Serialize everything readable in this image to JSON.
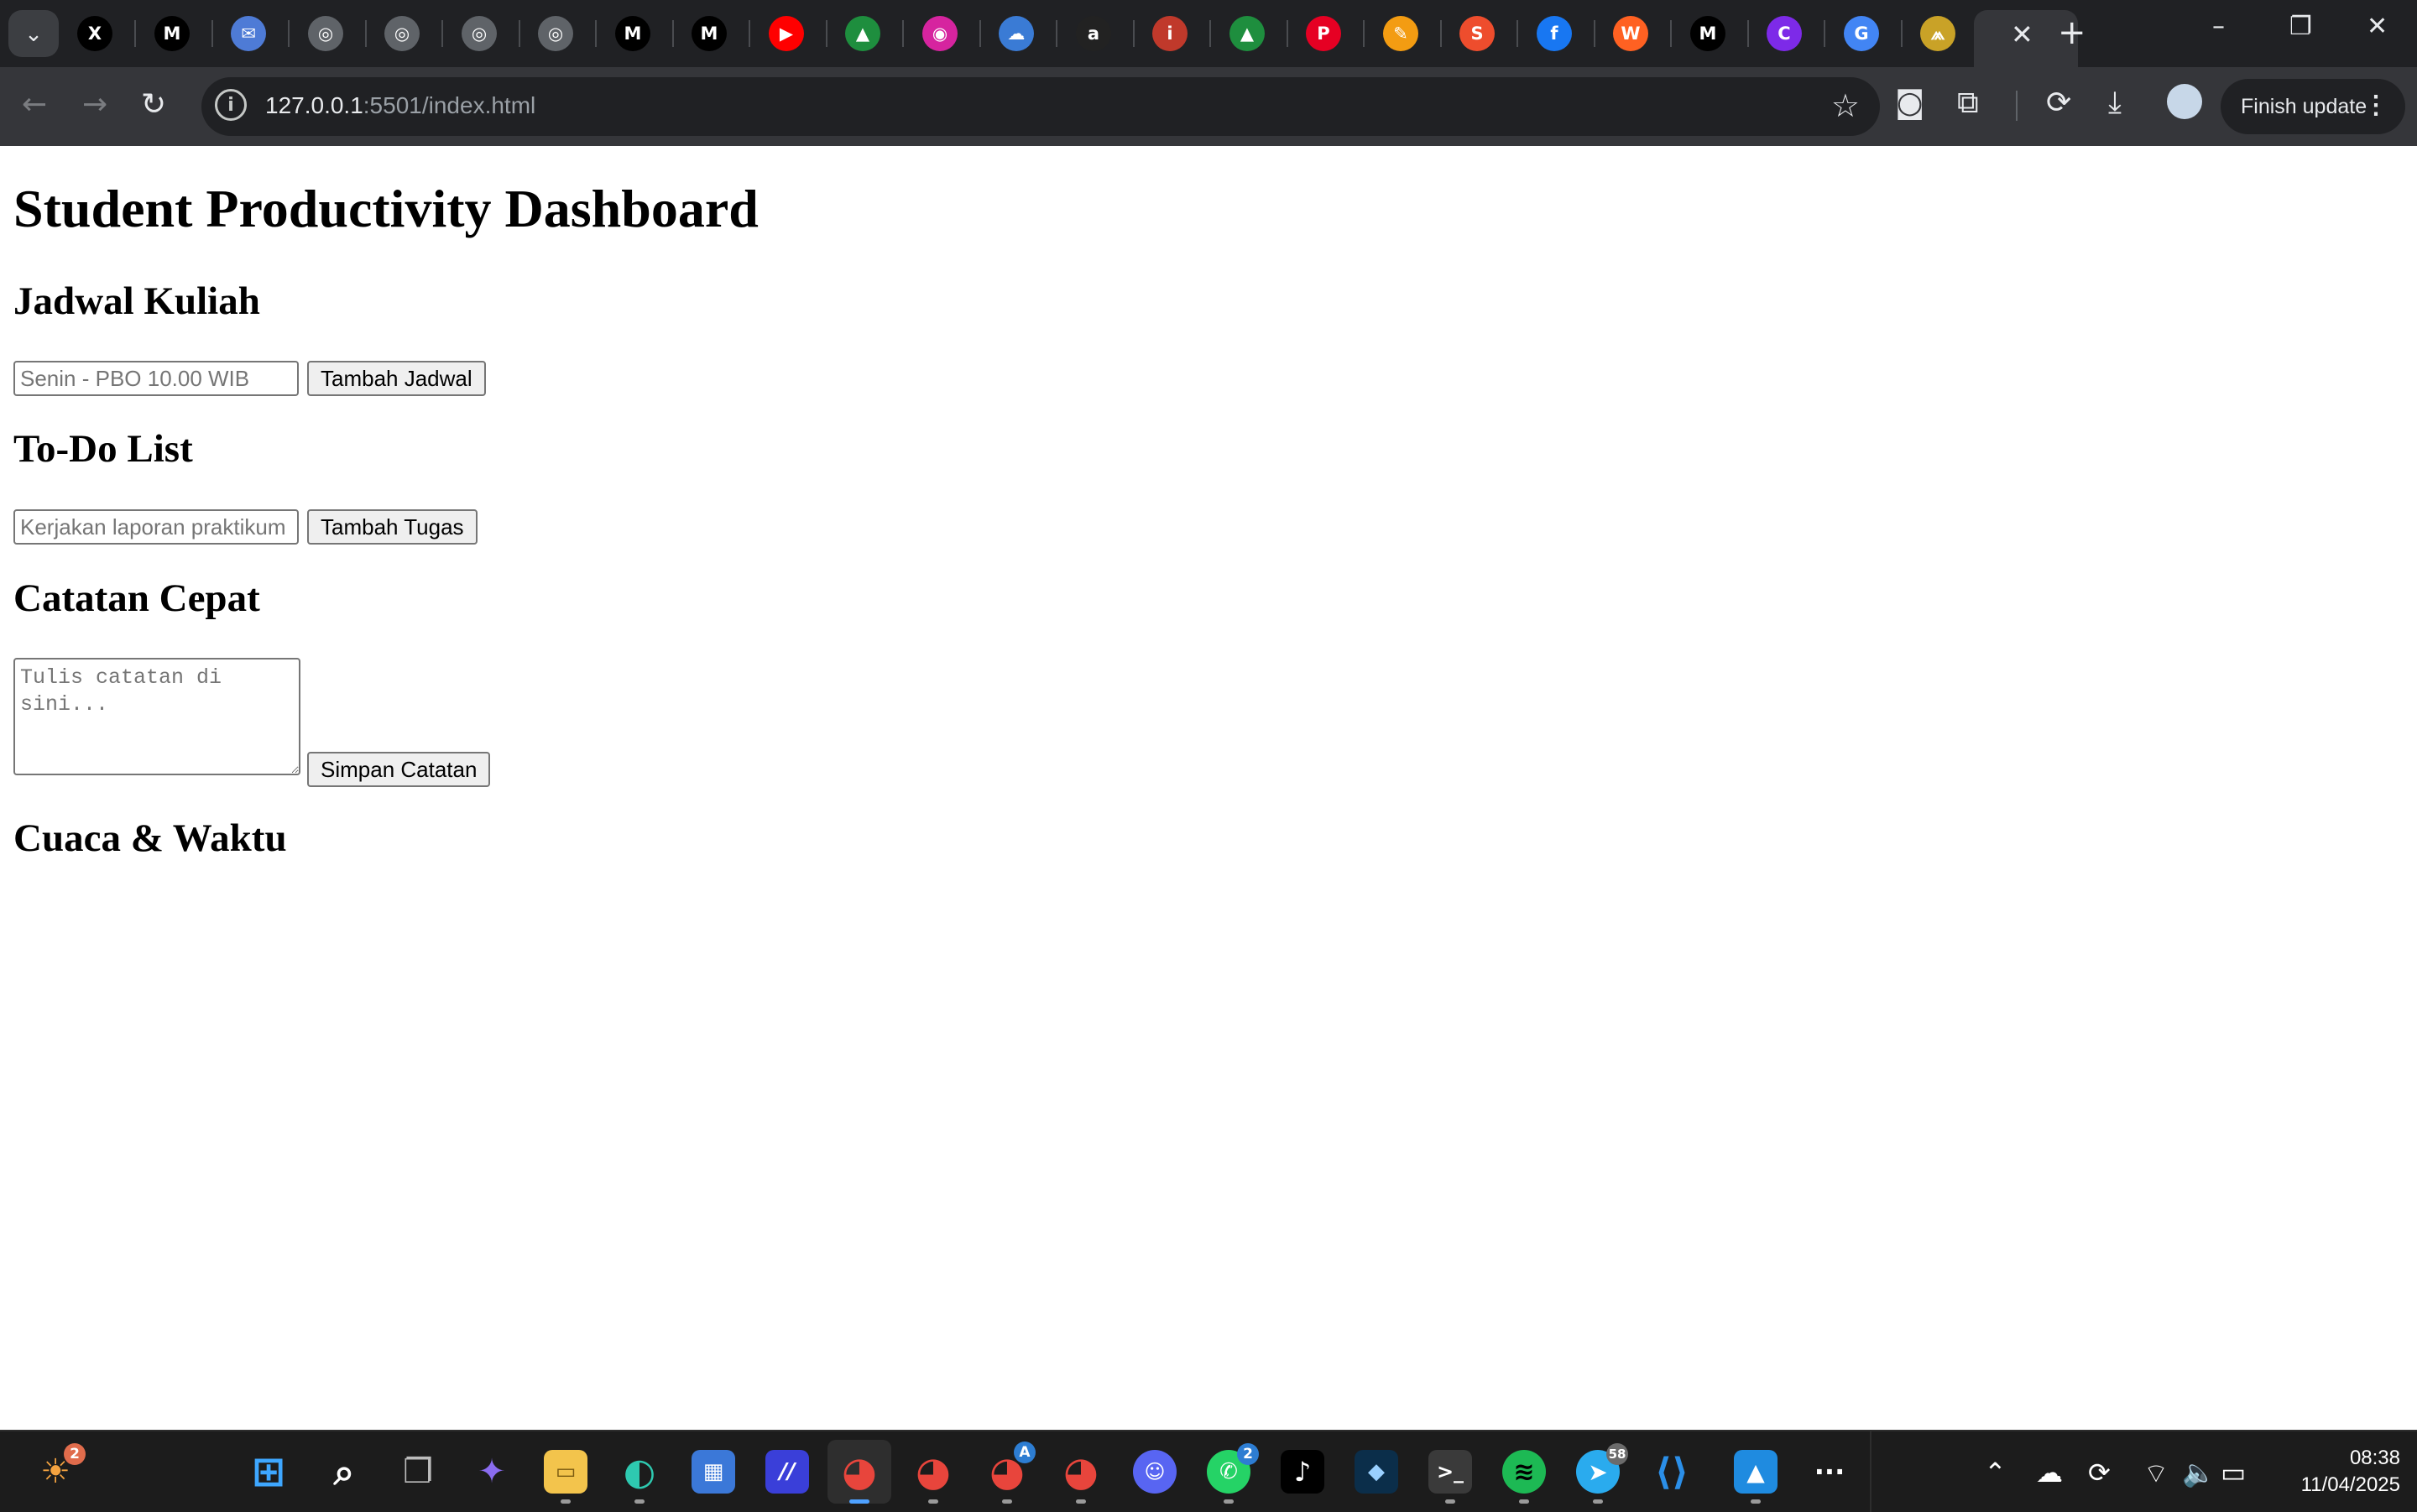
{
  "browser": {
    "url_host": "127.0.0.1",
    "url_path": ":5501/index.html",
    "finish_update_label": "Finish update",
    "tab_favicons": [
      {
        "name": "x-icon",
        "glyph": "X",
        "color": "#000000"
      },
      {
        "name": "medium-icon",
        "glyph": "M",
        "color": "#000000"
      },
      {
        "name": "mail-icon",
        "glyph": "✉",
        "color": "#4e7bd6"
      },
      {
        "name": "globe-icon",
        "glyph": "◎",
        "color": "#5f6368"
      },
      {
        "name": "globe-icon",
        "glyph": "◎",
        "color": "#5f6368"
      },
      {
        "name": "globe-icon",
        "glyph": "◎",
        "color": "#5f6368"
      },
      {
        "name": "globe-icon",
        "glyph": "◎",
        "color": "#5f6368"
      },
      {
        "name": "medium-icon",
        "glyph": "M",
        "color": "#000000"
      },
      {
        "name": "medium-icon",
        "glyph": "M",
        "color": "#000000"
      },
      {
        "name": "youtube-icon",
        "glyph": "▶",
        "color": "#ff0000"
      },
      {
        "name": "google-drive-icon",
        "glyph": "▲",
        "color": "#1e8e3e"
      },
      {
        "name": "instagram-icon",
        "glyph": "◉",
        "color": "#d6249f"
      },
      {
        "name": "cloud-icon",
        "glyph": "☁",
        "color": "#3a7bd5"
      },
      {
        "name": "script-icon",
        "glyph": "a",
        "color": "#222222"
      },
      {
        "name": "info-icon",
        "glyph": "i",
        "color": "#c0392b"
      },
      {
        "name": "google-drive-icon",
        "glyph": "▲",
        "color": "#1e8e3e"
      },
      {
        "name": "pinterest-icon",
        "glyph": "P",
        "color": "#e60023"
      },
      {
        "name": "pen-icon",
        "glyph": "✎",
        "color": "#f39c12"
      },
      {
        "name": "shopee-icon",
        "glyph": "S",
        "color": "#ee4d2d"
      },
      {
        "name": "facebook-icon",
        "glyph": "f",
        "color": "#1877f2"
      },
      {
        "name": "wattpad-icon",
        "glyph": "W",
        "color": "#ff6122"
      },
      {
        "name": "medium-icon",
        "glyph": "M",
        "color": "#000000"
      },
      {
        "name": "canva-icon",
        "glyph": "C",
        "color": "#7d2ae8"
      },
      {
        "name": "google-icon",
        "glyph": "G",
        "color": "#4285f4"
      },
      {
        "name": "campus-icon",
        "glyph": "⩕",
        "color": "#c9a227"
      }
    ]
  },
  "page": {
    "title": "Student Productivity Dashboard",
    "schedule": {
      "heading": "Jadwal Kuliah",
      "placeholder": "Senin - PBO 10.00 WIB",
      "button": "Tambah Jadwal"
    },
    "todo": {
      "heading": "To-Do List",
      "placeholder": "Kerjakan laporan praktikum",
      "button": "Tambah Tugas"
    },
    "notes": {
      "heading": "Catatan Cepat",
      "placeholder": "Tulis catatan di sini...",
      "button": "Simpan Catatan"
    },
    "weather": {
      "heading": "Cuaca & Waktu"
    }
  },
  "taskbar": {
    "weather_badge": "2",
    "whatsapp_badge": "2",
    "telegram_badge": "58",
    "chrome_profile_badge": "A",
    "time": "08:38",
    "date": "11/04/2025"
  }
}
